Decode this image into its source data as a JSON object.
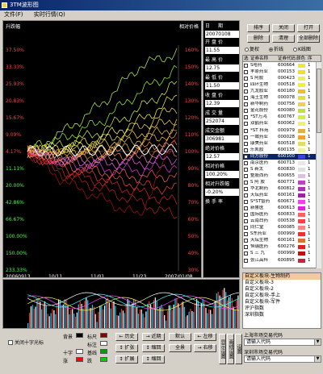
{
  "window": {
    "title": "3TM波形图"
  },
  "menu": [
    "文件(F)",
    "实时行情(Q)"
  ],
  "chart": {
    "left_title": "升跌幅",
    "right_title": "相对价格",
    "left_ticks": [
      "37.50%",
      "33.33%",
      "25.93%",
      "20.83%",
      "15.67%",
      "9.09%",
      "4.17%",
      "11.11%",
      "20.00%",
      "42.86%",
      "66.67%",
      "100.00%",
      "150.00%",
      "233.33%"
    ],
    "right_ticks": [
      "160%",
      "150%",
      "140%",
      "130%",
      "120%",
      "110%",
      "100%",
      "90%",
      "80%",
      "70%",
      "60%",
      "50%",
      "40%",
      "30%"
    ],
    "x_ticks": [
      "20060913",
      "10/11",
      "11/01",
      "11/23",
      "2007/01/08"
    ]
  },
  "chart_data": {
    "type": "line",
    "title": "",
    "xlabel": "",
    "ylabel": "相对价格",
    "x": [
      "20060913",
      "10/11",
      "11/01",
      "11/23",
      "2007/01/08"
    ],
    "ylim": [
      30,
      160
    ],
    "series": [
      {
        "values": [
          100,
          112,
          128,
          150,
          158
        ]
      },
      {
        "values": [
          100,
          108,
          118,
          135,
          148
        ]
      },
      {
        "values": [
          100,
          104,
          112,
          125,
          140
        ]
      },
      {
        "values": [
          100,
          102,
          108,
          118,
          132
        ]
      },
      {
        "values": [
          100,
          101,
          106,
          114,
          126
        ]
      },
      {
        "values": [
          100,
          100,
          104,
          110,
          120
        ]
      },
      {
        "values": [
          100,
          99,
          102,
          107,
          115
        ]
      },
      {
        "values": [
          100,
          98,
          100,
          104,
          112
        ]
      },
      {
        "values": [
          100,
          97,
          99,
          101,
          108
        ]
      },
      {
        "values": [
          100,
          96,
          97,
          99,
          104
        ]
      },
      {
        "values": [
          100,
          95,
          95,
          96,
          100
        ]
      },
      {
        "values": [
          100,
          94,
          93,
          93,
          96
        ]
      },
      {
        "values": [
          100,
          93,
          90,
          89,
          92
        ]
      },
      {
        "values": [
          100,
          92,
          88,
          85,
          86
        ]
      },
      {
        "values": [
          100,
          90,
          85,
          80,
          78
        ]
      },
      {
        "values": [
          100,
          88,
          82,
          76,
          70
        ]
      },
      {
        "values": [
          100,
          86,
          78,
          70,
          62
        ]
      },
      {
        "values": [
          100,
          82,
          72,
          62,
          110
        ]
      }
    ]
  },
  "info": {
    "date_label": "日　期",
    "date": "20070108",
    "open_label": "开盘价",
    "open": "11.55",
    "high_label": "最高价",
    "high": "12.75",
    "low_label": "最低价",
    "low": "11.50",
    "close_label": "收盘价",
    "close": "12.39",
    "vol_label": "成交量",
    "vol": "252074",
    "amt_label": "成交金额",
    "amt": "306981",
    "abs_label": "绝对价格",
    "abs": "12.57",
    "rel_label": "相对价格",
    "rel": "100.20%",
    "pct_label": "相对升跌幅",
    "pct": "-0.20%",
    "turn_label": "换手率",
    "turn": ""
  },
  "controls": {
    "sort": "排序",
    "close": "关闭",
    "open": "打开",
    "del": "删除",
    "clear": "清理",
    "delall": "全部删除",
    "radio1": "复权",
    "radio2": "折线",
    "radio3": "K线图"
  },
  "stock_header": {
    "sel": "选",
    "name": "证券名称",
    "code": "证券代码",
    "color": "颜色",
    "idx": "序"
  },
  "stocks": [
    {
      "name": "S哈药",
      "code": "600664",
      "color": "#e8e840",
      "idx": "1"
    },
    {
      "name": "丰原药业",
      "code": "000153",
      "color": "#f0e020",
      "idx": "1"
    },
    {
      "name": "S 阿胶",
      "code": "000423",
      "color": "#e8f060",
      "idx": "1"
    },
    {
      "name": "四环生物",
      "code": "000518",
      "color": "#f0f030",
      "idx": "1"
    },
    {
      "name": "九龙胶业",
      "code": "600180",
      "color": "#f0c020",
      "idx": "1"
    },
    {
      "name": "海王生物",
      "code": "000078",
      "color": "#e0e040",
      "idx": "1"
    },
    {
      "name": "新华制药",
      "code": "000756",
      "color": "#f0d050",
      "idx": "1"
    },
    {
      "name": "金花股份",
      "code": "600080",
      "color": "#c0e040",
      "idx": "1"
    },
    {
      "name": "*ST万鸿",
      "code": "600767",
      "color": "#d0f040",
      "idx": "1"
    },
    {
      "name": "双鹤药业",
      "code": "600062",
      "color": "#f0f070",
      "idx": "1"
    },
    {
      "name": "*ST 科苑",
      "code": "000979",
      "color": "#e0b040",
      "idx": "1"
    },
    {
      "name": "一致药业",
      "code": "000028",
      "color": "#f0a030",
      "idx": "1"
    },
    {
      "name": "康美药业",
      "code": "600518",
      "color": "#e0e060",
      "idx": "1"
    },
    {
      "name": "乐凯胶",
      "code": "600135",
      "color": "#f0f0a0",
      "idx": "1"
    },
    {
      "name": "同方股份",
      "code": "600100",
      "color": "#4040e0",
      "idx": "1"
    },
    {
      "name": "南京医药",
      "code": "600713",
      "color": "#e8e8e8",
      "idx": "1"
    },
    {
      "name": "S 新太",
      "code": "600830",
      "color": "#e0e0e0",
      "idx": "1"
    },
    {
      "name": "整股西药",
      "code": "600655",
      "color": "#e0c0e0",
      "idx": "1"
    },
    {
      "name": "S 阿 胶",
      "code": "600771",
      "color": "#c040c0",
      "idx": "1"
    },
    {
      "name": "华北制药",
      "code": "600812",
      "color": "#b030b0",
      "idx": "1"
    },
    {
      "name": "天坛药业",
      "code": "600161",
      "color": "#a020a0",
      "idx": "1"
    },
    {
      "name": "S*ST智药",
      "code": "600671",
      "color": "#f040f0",
      "idx": "1"
    },
    {
      "name": "新鲁医",
      "code": "600613",
      "color": "#e020e0",
      "idx": "1"
    },
    {
      "name": "国际医药",
      "code": "600833",
      "color": "#ff6060",
      "idx": "1"
    },
    {
      "name": "云南白药",
      "code": "000538",
      "color": "#ff4040",
      "idx": "1"
    },
    {
      "name": "同仁堂",
      "code": "600085",
      "color": "#ff8080",
      "idx": "1"
    },
    {
      "name": "S东药业",
      "code": "000999",
      "color": "#f03030",
      "idx": "1"
    },
    {
      "name": "天坛生物",
      "code": "600161",
      "color": "#e07030",
      "idx": "1"
    },
    {
      "name": "恒瑞医药",
      "code": "600276",
      "color": "#e02020",
      "idx": "1"
    },
    {
      "name": "S 三 九",
      "code": "000999",
      "color": "#c01010",
      "idx": "1"
    },
    {
      "name": "张江高科",
      "code": "600895",
      "color": "#d02040",
      "idx": "1"
    }
  ],
  "sectors": [
    "自定义板块-生物制药",
    "自定义板块-3",
    "自定义板块-2",
    "自定义板块-手上",
    "自定义板块-军件",
    "评沪指数",
    "深圳指数"
  ],
  "bottom": {
    "crosshair": "关闭十字光标",
    "bg": "背景",
    "k_label": "标尺",
    "nav": "标注",
    "cross": "十字",
    "base": "基线",
    "up": "涨",
    "down": "跌",
    "hist": "← 历史",
    "near": "→ 近期",
    "default": "默认",
    "left": "← 左移",
    "expand1": "↕ 扩张",
    "shrink1": "↕ 缩回",
    "full": "全景",
    "right": "→ 右移",
    "expand2": "↕ 扩展",
    "shrink2": "↕ 缩回",
    "side1": "显示设置",
    "side2": "画线设置",
    "side3": "设置",
    "sh_label": "上海市场交易代码",
    "sz_label": "深圳市场交易代码",
    "sh_value": "请输入代码",
    "sz_value": "请输入代码"
  },
  "colors": {
    "bg": "#000000",
    "k": "#8b0000",
    "nav": "#ffffff",
    "cross": "#ffffff",
    "base": "#00a000",
    "up": "#ff0000",
    "down": "#00d000"
  }
}
